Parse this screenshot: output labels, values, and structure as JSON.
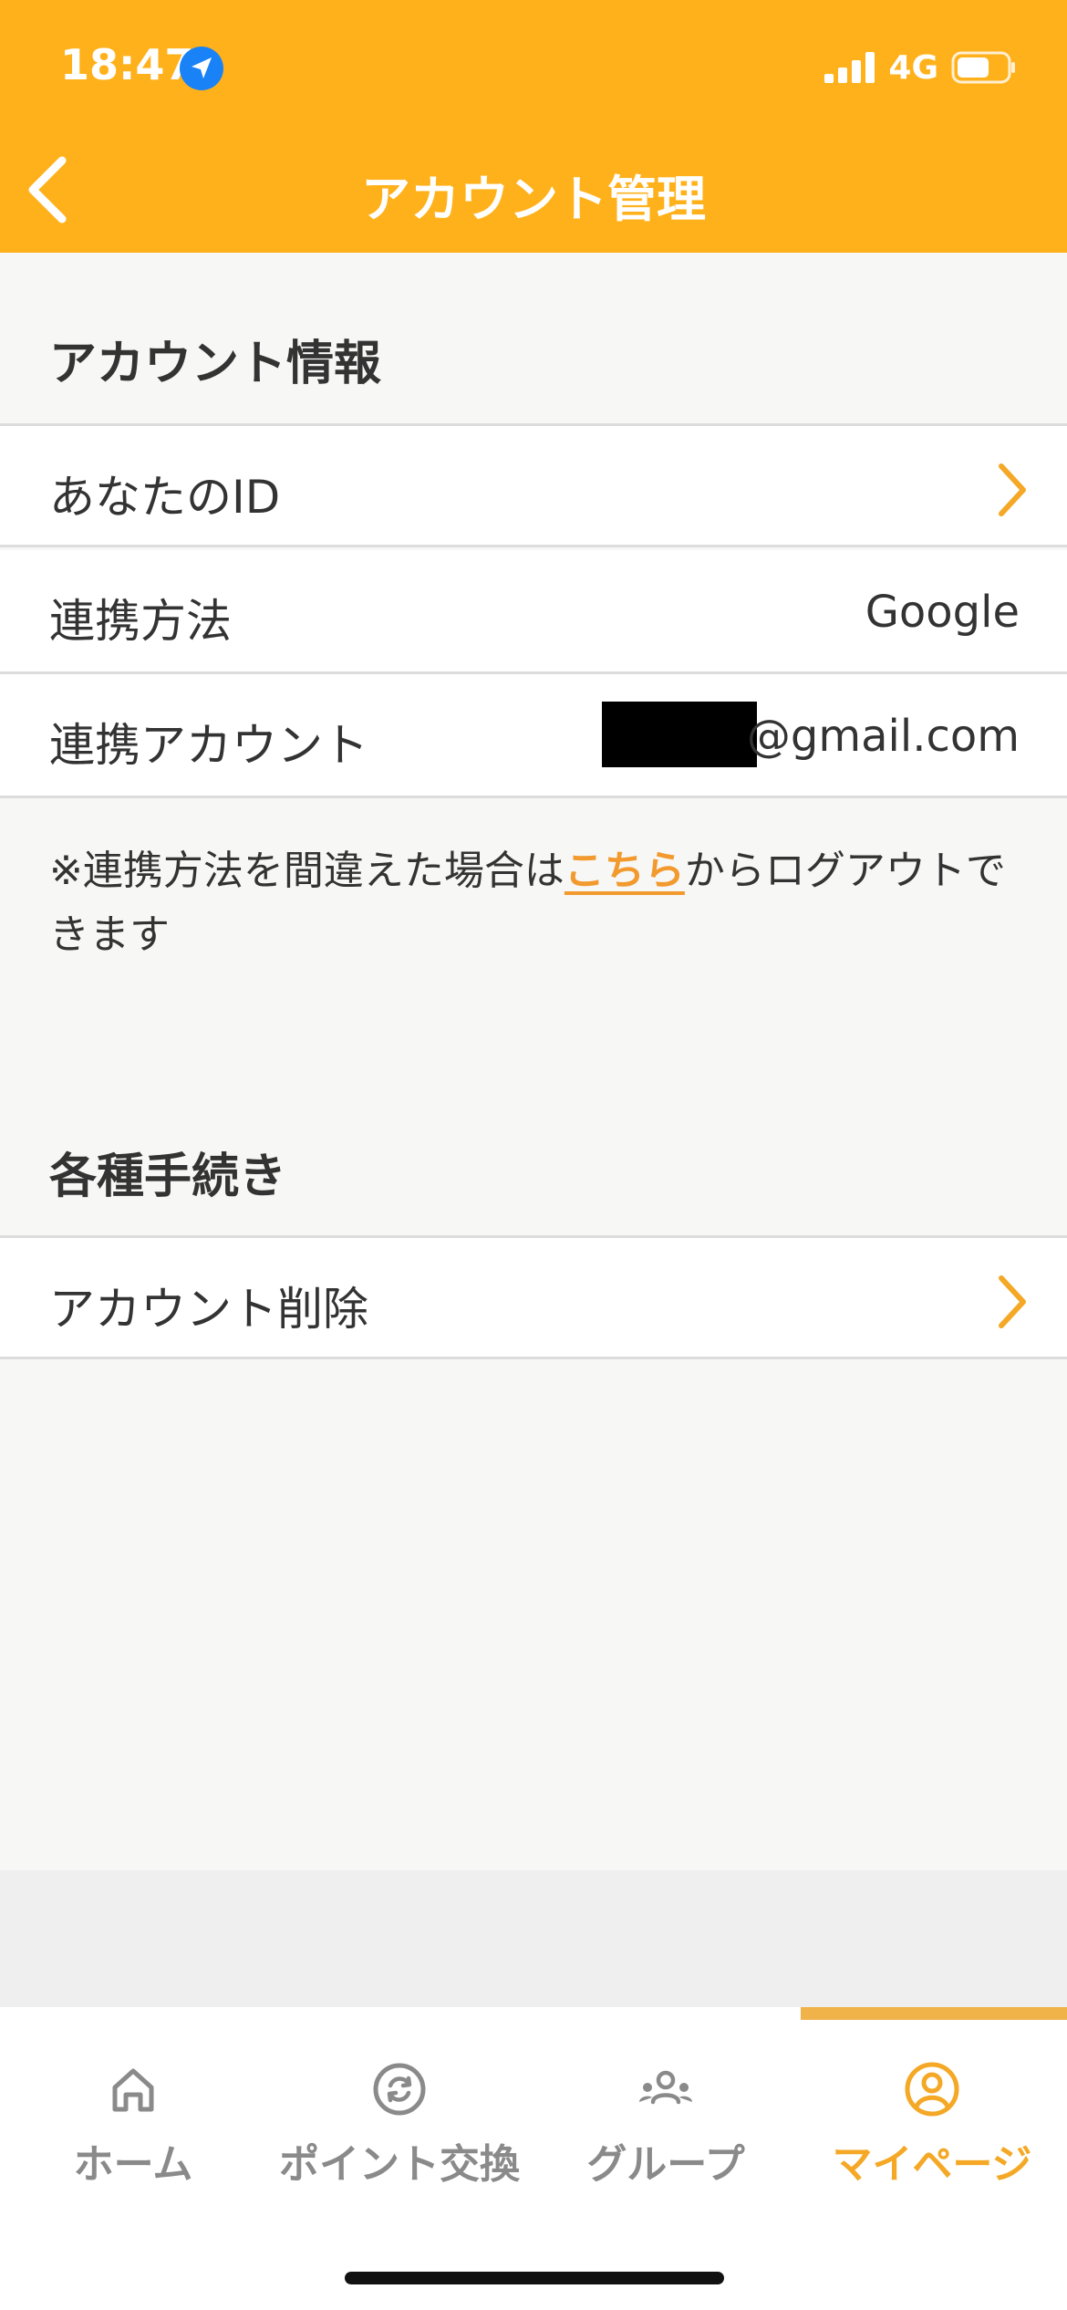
{
  "status_bar": {
    "time": "18:47",
    "network": "4G"
  },
  "nav": {
    "title": "アカウント管理"
  },
  "account_info": {
    "section_title": "アカウント情報",
    "rows": [
      {
        "label": "あなたのID"
      },
      {
        "label": "連携方法",
        "value": "Google"
      },
      {
        "label": "連携アカウント",
        "value": "@gmail.com"
      }
    ],
    "note_before": "※連携方法を間違えた場合は",
    "note_link": "こちら",
    "note_after": "からログアウトできます"
  },
  "procedures": {
    "section_title": "各種手続き",
    "rows": [
      {
        "label": "アカウント削除"
      }
    ]
  },
  "tabbar": {
    "tabs": [
      {
        "label": "ホーム",
        "icon": "home-icon"
      },
      {
        "label": "ポイント交換",
        "icon": "exchange-icon"
      },
      {
        "label": "グループ",
        "icon": "group-icon"
      },
      {
        "label": "マイページ",
        "icon": "user-icon"
      }
    ],
    "active": "マイページ"
  },
  "colors": {
    "header": "#ffb11b",
    "accent": "#f4a826",
    "link": "#f29a2e"
  }
}
